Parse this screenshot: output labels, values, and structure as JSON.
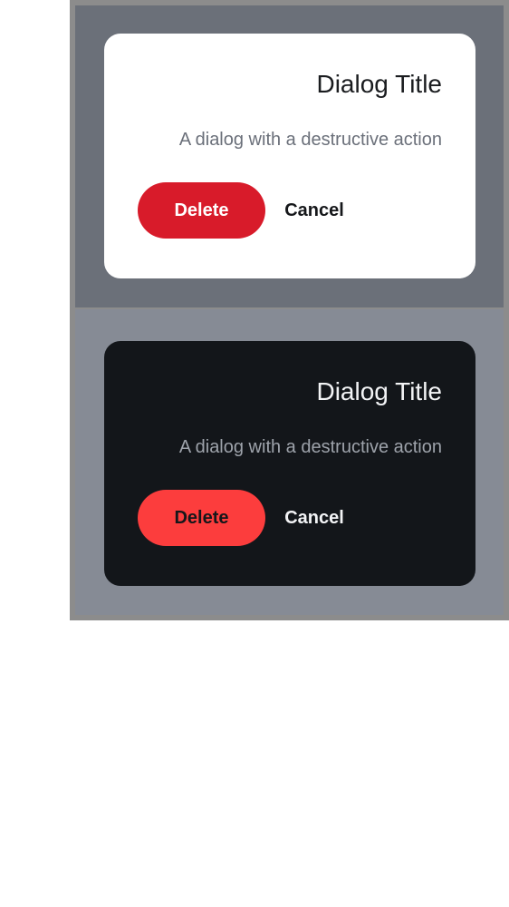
{
  "light_dialog": {
    "title": "Dialog Title",
    "body": "A dialog with a destructive action",
    "delete_label": "Delete",
    "cancel_label": "Cancel",
    "colors": {
      "background": "#ffffff",
      "delete_button": "#d81b2a",
      "backdrop": "#6b7079"
    }
  },
  "dark_dialog": {
    "title": "Dialog Title",
    "body": "A dialog with a destructive action",
    "delete_label": "Delete",
    "cancel_label": "Cancel",
    "colors": {
      "background": "#13161a",
      "delete_button": "#fc3d3d",
      "backdrop": "#868b95"
    }
  }
}
